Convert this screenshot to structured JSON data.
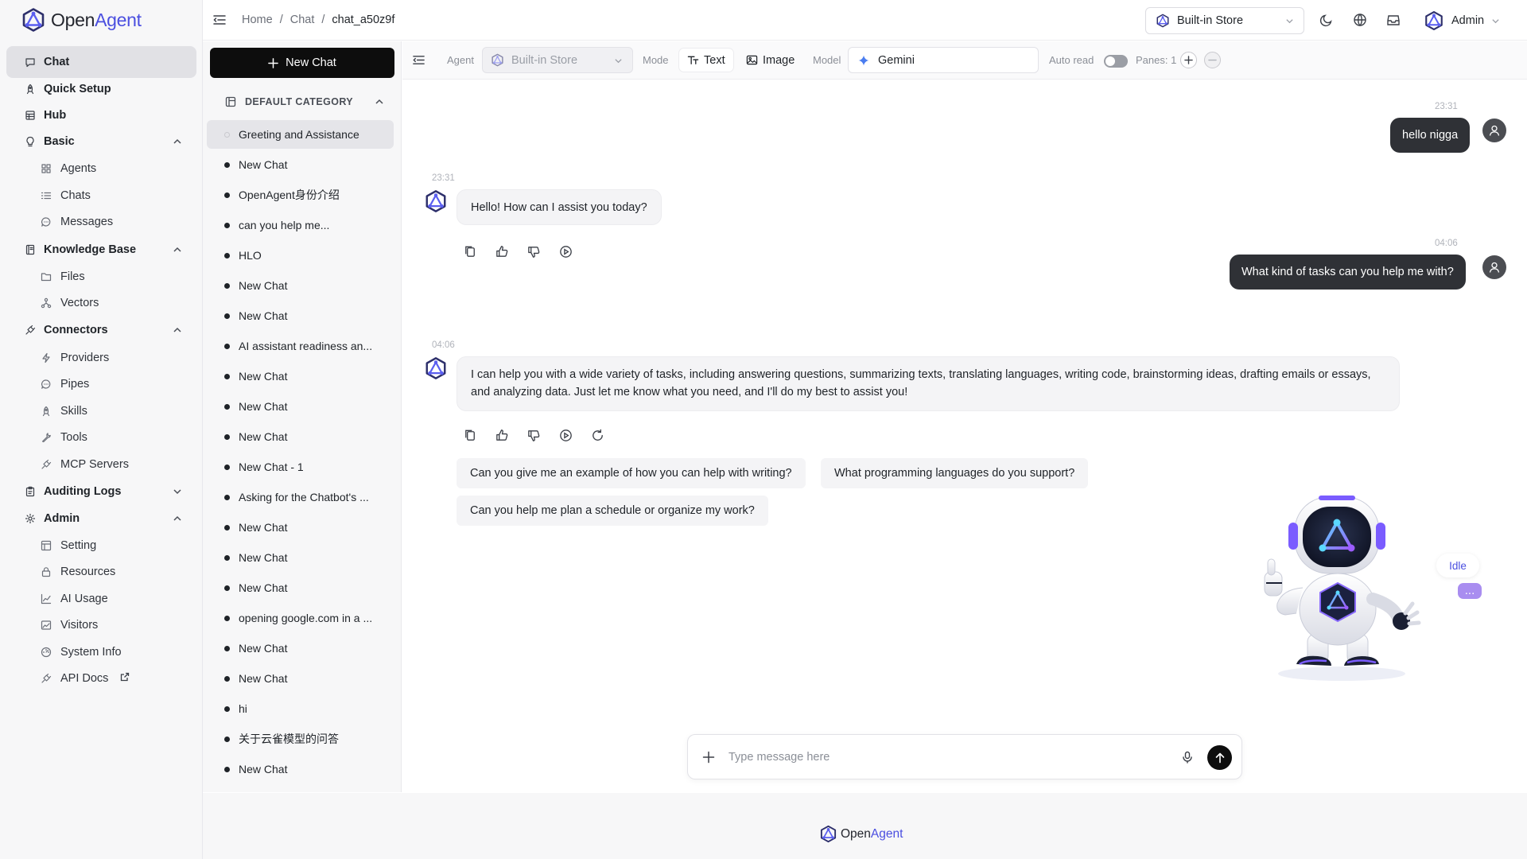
{
  "brand": {
    "name_a": "Open",
    "name_b": "Agent"
  },
  "sidebar": {
    "items": [
      {
        "label": "Chat",
        "icon": "chat-bubble-icon",
        "active": true
      },
      {
        "label": "Quick Setup",
        "icon": "rocket-icon"
      },
      {
        "label": "Hub",
        "icon": "store-icon"
      },
      {
        "label": "Basic",
        "icon": "lightbulb-icon",
        "expanded": true
      },
      {
        "label": "Agents",
        "icon": "grid-icon",
        "sub": true
      },
      {
        "label": "Chats",
        "icon": "list-icon",
        "sub": true
      },
      {
        "label": "Messages",
        "icon": "message-circle-icon",
        "sub": true
      },
      {
        "label": "Knowledge Base",
        "icon": "book-icon",
        "expanded": true
      },
      {
        "label": "Files",
        "icon": "folder-icon",
        "sub": true
      },
      {
        "label": "Vectors",
        "icon": "network-icon",
        "sub": true
      },
      {
        "label": "Connectors",
        "icon": "plug-icon",
        "expanded": true
      },
      {
        "label": "Providers",
        "icon": "zap-icon",
        "sub": true
      },
      {
        "label": "Pipes",
        "icon": "message-circle-icon",
        "sub": true
      },
      {
        "label": "Skills",
        "icon": "rocket-icon",
        "sub": true
      },
      {
        "label": "Tools",
        "icon": "wrench-icon",
        "sub": true
      },
      {
        "label": "MCP Servers",
        "icon": "plug-icon",
        "sub": true
      },
      {
        "label": "Auditing Logs",
        "icon": "clipboard-icon",
        "expanded": false
      },
      {
        "label": "Admin",
        "icon": "settings-icon",
        "expanded": true
      },
      {
        "label": "Setting",
        "icon": "layout-icon",
        "sub": true
      },
      {
        "label": "Resources",
        "icon": "lock-icon",
        "sub": true
      },
      {
        "label": "AI Usage",
        "icon": "line-chart-icon",
        "sub": true
      },
      {
        "label": "Visitors",
        "icon": "image-chart-icon",
        "sub": true
      },
      {
        "label": "System Info",
        "icon": "gauge-icon",
        "sub": true
      },
      {
        "label": "API Docs",
        "icon": "plug-icon",
        "sub": true,
        "external": true
      }
    ]
  },
  "header": {
    "breadcrumb": [
      "Home",
      "/",
      "Chat",
      "/",
      "chat_a50z9f"
    ],
    "store": "Built-in Store",
    "user": "Admin"
  },
  "chatlist": {
    "new_chat": "New Chat",
    "category": "DEFAULT CATEGORY",
    "items": [
      "Greeting and Assistance",
      "New Chat",
      "OpenAgent身份介绍",
      "can you help me...",
      "HLO",
      "New Chat",
      "New Chat",
      "AI assistant readiness an...",
      "New Chat",
      "New Chat",
      "New Chat",
      "New Chat - 1",
      "Asking for the Chatbot's ...",
      "New Chat",
      "New Chat",
      "New Chat",
      "opening google.com in a ...",
      "New Chat",
      "New Chat",
      "hi",
      "关于云雀模型的问答",
      "New Chat"
    ]
  },
  "toolbar": {
    "agent_label": "Agent",
    "agent_value": "Built-in Store",
    "mode_label": "Mode",
    "mode_text": "Text",
    "mode_image": "Image",
    "model_label": "Model",
    "model_value": "Gemini",
    "auto_read": "Auto read",
    "auto_read_on": false,
    "panes": "Panes: 1"
  },
  "messages": {
    "m1_time": "23:31",
    "m1_text": "hello nigga",
    "m2_time": "23:31",
    "m2_text": "Hello! How can I assist you today?",
    "m3_time": "04:06",
    "m3_text": "What kind of tasks can you help me with?",
    "m4_time": "04:06",
    "m4_text": "I can help you with a wide variety of tasks, including answering questions, summarizing texts, translating languages, writing code, brainstorming ideas, drafting emails or essays, and analyzing data. Just let me know what you need, and I'll do my best to assist you!",
    "suggestions": [
      "Can you give me an example of how you can help with writing?",
      "What programming languages do you support?",
      "Can you help me plan a schedule or organize my work?"
    ]
  },
  "mascot": {
    "status": "Idle",
    "dots": "..."
  },
  "composer": {
    "placeholder": "Type message here"
  },
  "colors": {
    "accent": "#4b4fe0",
    "user_bubble": "#2f3136",
    "primary_button": "#0d0d0d"
  }
}
